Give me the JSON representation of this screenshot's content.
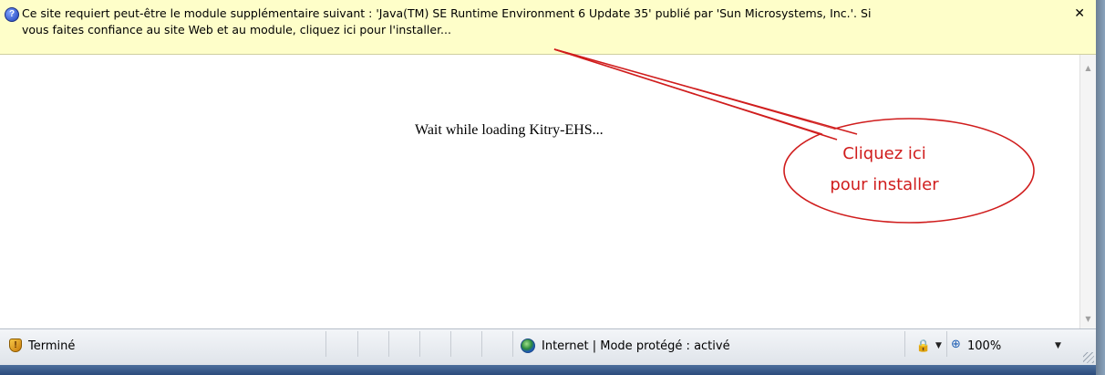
{
  "infobar": {
    "message": "Ce site requiert peut-être le module supplémentaire suivant : 'Java(TM) SE Runtime Environment 6 Update 35' publié par 'Sun Microsystems, Inc.'. Si\nvous faites confiance au site Web et au module, cliquez ici pour l'installer...",
    "close_glyph": "✕"
  },
  "content": {
    "loading_text": "Wait while loading Kitry-EHS..."
  },
  "annotation": {
    "line1": "Cliquez ici",
    "line2": "pour installer",
    "color": "#d01d1d"
  },
  "statusbar": {
    "status": "Terminé",
    "zone": "Internet | Mode protégé : activé",
    "zoom": "100%"
  },
  "icons": {
    "info": "info-icon",
    "shield": "shield-warning-icon",
    "globe": "globe-icon",
    "lock": "protected-mode-icon",
    "zoom": "magnifier-icon"
  }
}
